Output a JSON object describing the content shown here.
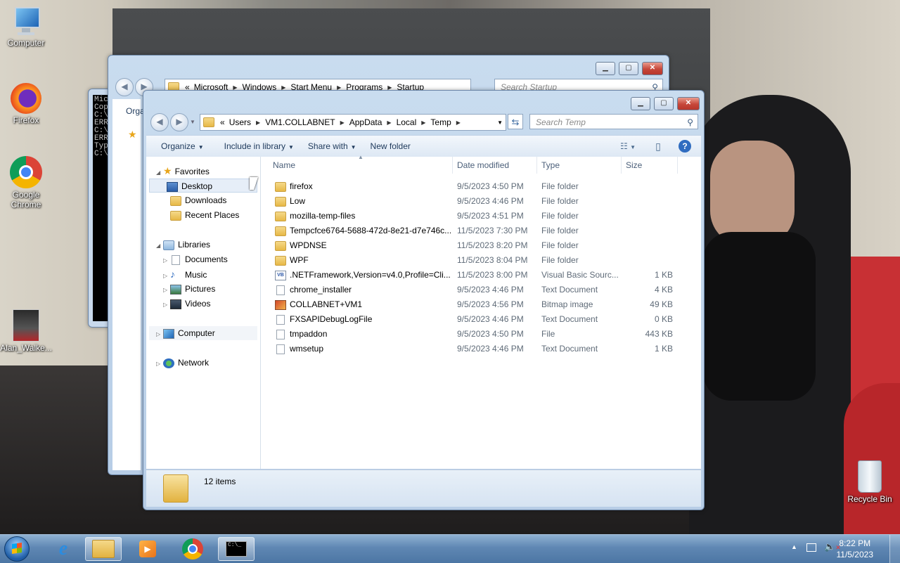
{
  "desktop": {
    "icons": [
      {
        "label": "Computer"
      },
      {
        "label": "Firefox"
      },
      {
        "label": "Google Chrome"
      },
      {
        "label": "Alan_Walke..."
      },
      {
        "label": "Recycle Bin"
      }
    ]
  },
  "back_window": {
    "breadcrumb": [
      "Microsoft",
      "Windows",
      "Start Menu",
      "Programs",
      "Startup"
    ],
    "search_placeholder": "Search Startup",
    "toolbar_partial": "Orga"
  },
  "cmd_window": {
    "lines": [
      "Mic",
      "Cop",
      "",
      "C:\\",
      "ERR",
      "",
      "C:\\",
      "ERR",
      "Typ",
      "",
      "C:\\"
    ]
  },
  "explorer": {
    "breadcrumb": [
      "Users",
      "VM1.COLLABNET",
      "AppData",
      "Local",
      "Temp"
    ],
    "search_placeholder": "Search Temp",
    "toolbar": {
      "organize": "Organize",
      "include_in_library": "Include in library",
      "share_with": "Share with",
      "new_folder": "New folder"
    },
    "nav": {
      "favorites": "Favorites",
      "desktop": "Desktop",
      "downloads": "Downloads",
      "recent_places": "Recent Places",
      "libraries": "Libraries",
      "documents": "Documents",
      "music": "Music",
      "pictures": "Pictures",
      "videos": "Videos",
      "computer": "Computer",
      "network": "Network"
    },
    "columns": {
      "name": "Name",
      "date": "Date modified",
      "type": "Type",
      "size": "Size"
    },
    "files": [
      {
        "name": "firefox",
        "date": "9/5/2023 4:50 PM",
        "type": "File folder",
        "size": "",
        "icon": "folder"
      },
      {
        "name": "Low",
        "date": "9/5/2023 4:46 PM",
        "type": "File folder",
        "size": "",
        "icon": "folder"
      },
      {
        "name": "mozilla-temp-files",
        "date": "9/5/2023 4:51 PM",
        "type": "File folder",
        "size": "",
        "icon": "folder"
      },
      {
        "name": "Tempcfce6764-5688-472d-8e21-d7e746c...",
        "date": "11/5/2023 7:30 PM",
        "type": "File folder",
        "size": "",
        "icon": "folder"
      },
      {
        "name": "WPDNSE",
        "date": "11/5/2023 8:20 PM",
        "type": "File folder",
        "size": "",
        "icon": "folder"
      },
      {
        "name": "WPF",
        "date": "11/5/2023 8:04 PM",
        "type": "File folder",
        "size": "",
        "icon": "folder"
      },
      {
        "name": ".NETFramework,Version=v4.0,Profile=Cli...",
        "date": "11/5/2023 8:00 PM",
        "type": "Visual Basic Sourc...",
        "size": "1 KB",
        "icon": "vbs"
      },
      {
        "name": "chrome_installer",
        "date": "9/5/2023 4:46 PM",
        "type": "Text Document",
        "size": "4 KB",
        "icon": "doc"
      },
      {
        "name": "COLLABNET+VM1",
        "date": "9/5/2023 4:56 PM",
        "type": "Bitmap image",
        "size": "49 KB",
        "icon": "bmp"
      },
      {
        "name": "FXSAPIDebugLogFile",
        "date": "9/5/2023 4:46 PM",
        "type": "Text Document",
        "size": "0 KB",
        "icon": "doc"
      },
      {
        "name": "tmpaddon",
        "date": "9/5/2023 4:50 PM",
        "type": "File",
        "size": "443 KB",
        "icon": "doc"
      },
      {
        "name": "wmsetup",
        "date": "9/5/2023 4:46 PM",
        "type": "Text Document",
        "size": "1 KB",
        "icon": "doc"
      }
    ],
    "status": "12 items"
  },
  "taskbar": {
    "time": "8:22 PM",
    "date": "11/5/2023"
  }
}
